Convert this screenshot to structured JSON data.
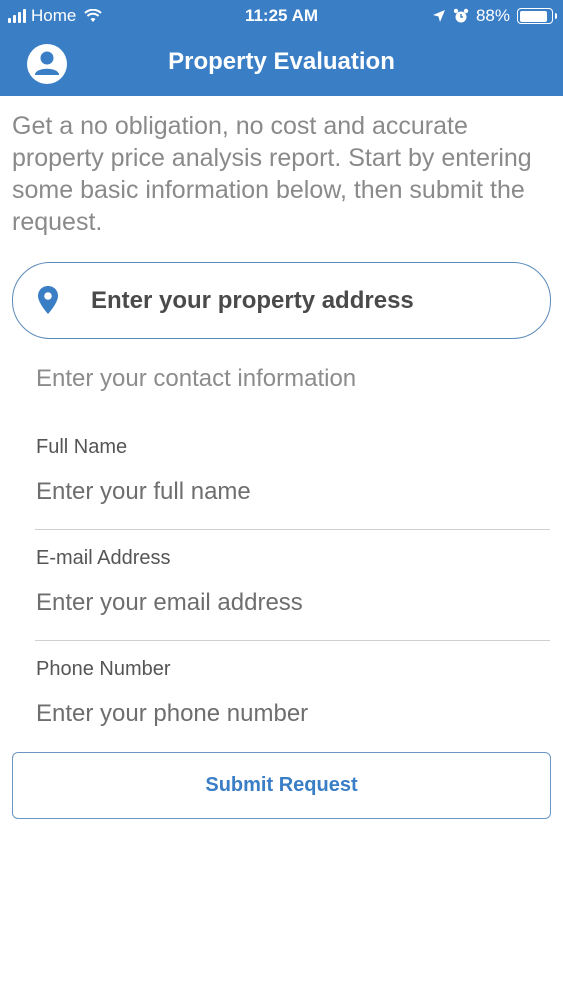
{
  "status_bar": {
    "carrier": "Home",
    "time": "11:25 AM",
    "battery_percent_label": "88%",
    "battery_level": 0.88,
    "icons": [
      "signal-icon",
      "wifi-icon",
      "location-arrow-icon",
      "alarm-clock-icon",
      "battery-icon"
    ]
  },
  "header": {
    "title": "Property Evaluation",
    "avatar_icon": "user-avatar-icon",
    "background_color": "#3a7ec6"
  },
  "intro_text": "Get a no obligation, no cost and accurate property price analysis report. Start by entering some basic information below, then submit the request.",
  "address": {
    "placeholder": "Enter your property address",
    "icon": "map-pin-icon"
  },
  "contact": {
    "heading": "Enter your contact information",
    "fields": [
      {
        "label": "Full Name",
        "placeholder": "Enter your full name"
      },
      {
        "label": "E-mail Address",
        "placeholder": "Enter your email address"
      },
      {
        "label": "Phone Number",
        "placeholder": "Enter your phone number"
      }
    ]
  },
  "submit_label": "Submit Request",
  "colors": {
    "accent": "#3a7ec6",
    "text_muted": "#8a8a8a"
  }
}
